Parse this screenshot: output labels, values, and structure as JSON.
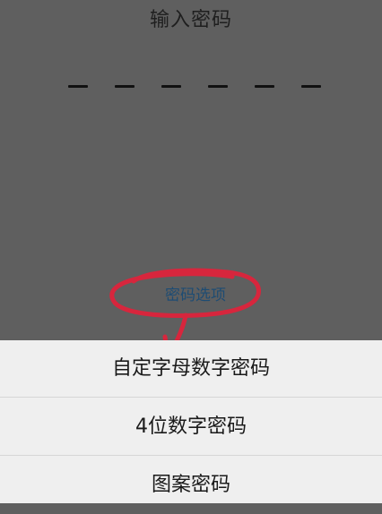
{
  "screen": {
    "title": "输入密码",
    "password_slots": 6,
    "options_link": "密码选项"
  },
  "options_sheet": {
    "items": [
      {
        "label": "自定字母数字密码"
      },
      {
        "label": "4位数字密码"
      },
      {
        "label": "图案密码"
      }
    ]
  },
  "annotation": {
    "color": "#d7263d"
  }
}
